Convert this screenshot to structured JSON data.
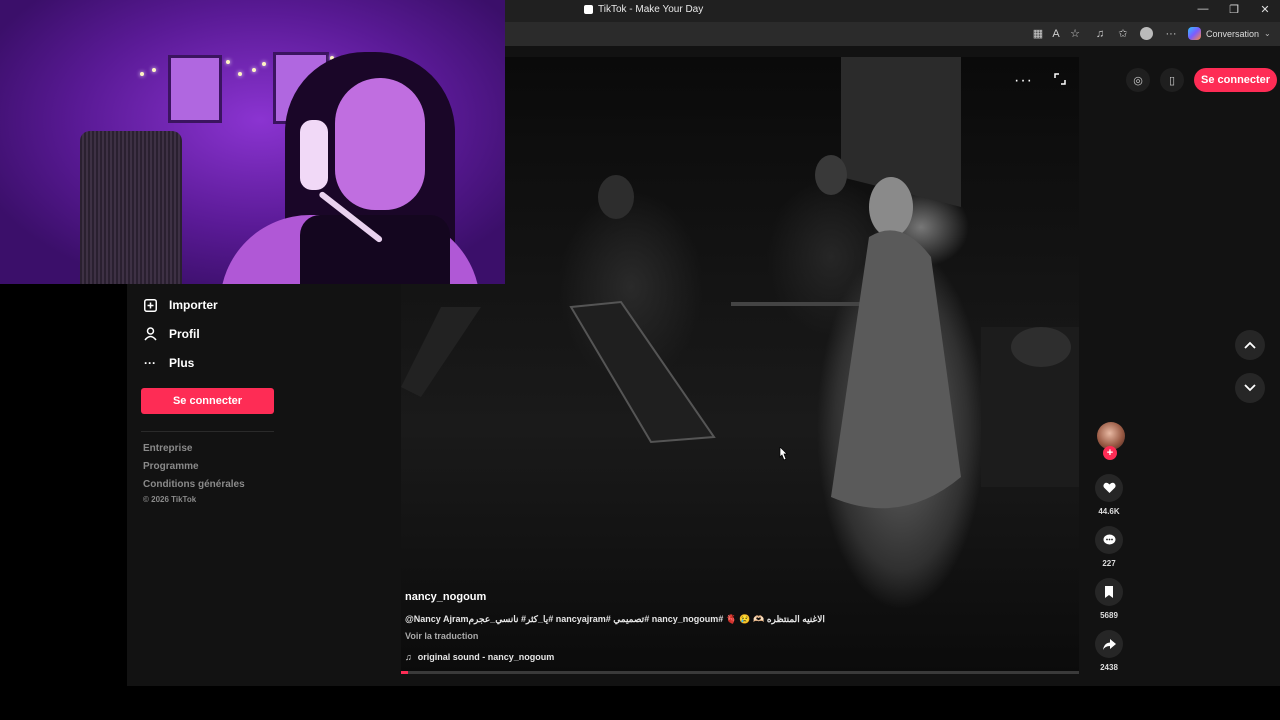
{
  "browser": {
    "tab_title": "TikTok - Make Your Day",
    "copilot_label": "Conversation"
  },
  "header": {
    "login_label": "Se connecter"
  },
  "sidebar": {
    "items": [
      {
        "label": "Importer",
        "icon": "plus-square-icon"
      },
      {
        "label": "Profil",
        "icon": "person-icon"
      },
      {
        "label": "Plus",
        "icon": "more-icon"
      }
    ],
    "login_label": "Se connecter",
    "footer_links": [
      "Entreprise",
      "Programme",
      "Conditions générales"
    ],
    "copyright": "© 2026 TikTok"
  },
  "video": {
    "author": "nancy_nogoum",
    "caption": "@Nancy Ajramيا_كثر# نانسي_عجرم# nancyajram# تصميمي# nancy_nogoum# 🫀 😢 🫶🏻 الاغنيه المنتظره",
    "translate_label": "Voir la traduction",
    "sound": "original sound - nancy_nogoum",
    "progress": 0.01
  },
  "actions": {
    "likes": "44.6K",
    "comments": "227",
    "saves": "5689",
    "shares": "2438"
  },
  "colors": {
    "accent": "#fe2c55",
    "page_bg": "#121212"
  }
}
